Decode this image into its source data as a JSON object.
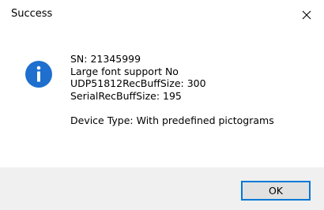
{
  "window": {
    "title": "Success"
  },
  "icons": {
    "info": "info-icon",
    "close": "close-icon"
  },
  "message": {
    "lines": [
      "SN: 21345999",
      "Large font support No",
      "UDP51812RecBuffSize: 300",
      "SerialRecBuffSize: 195"
    ],
    "device_type": "Device Type: With predefined pictograms"
  },
  "buttons": {
    "ok_label": "OK"
  },
  "colors": {
    "info_icon": "#1e6fce",
    "accent_border": "#0078d7",
    "footer_background": "#f0f0f0",
    "button_background": "#e1e1e1"
  }
}
